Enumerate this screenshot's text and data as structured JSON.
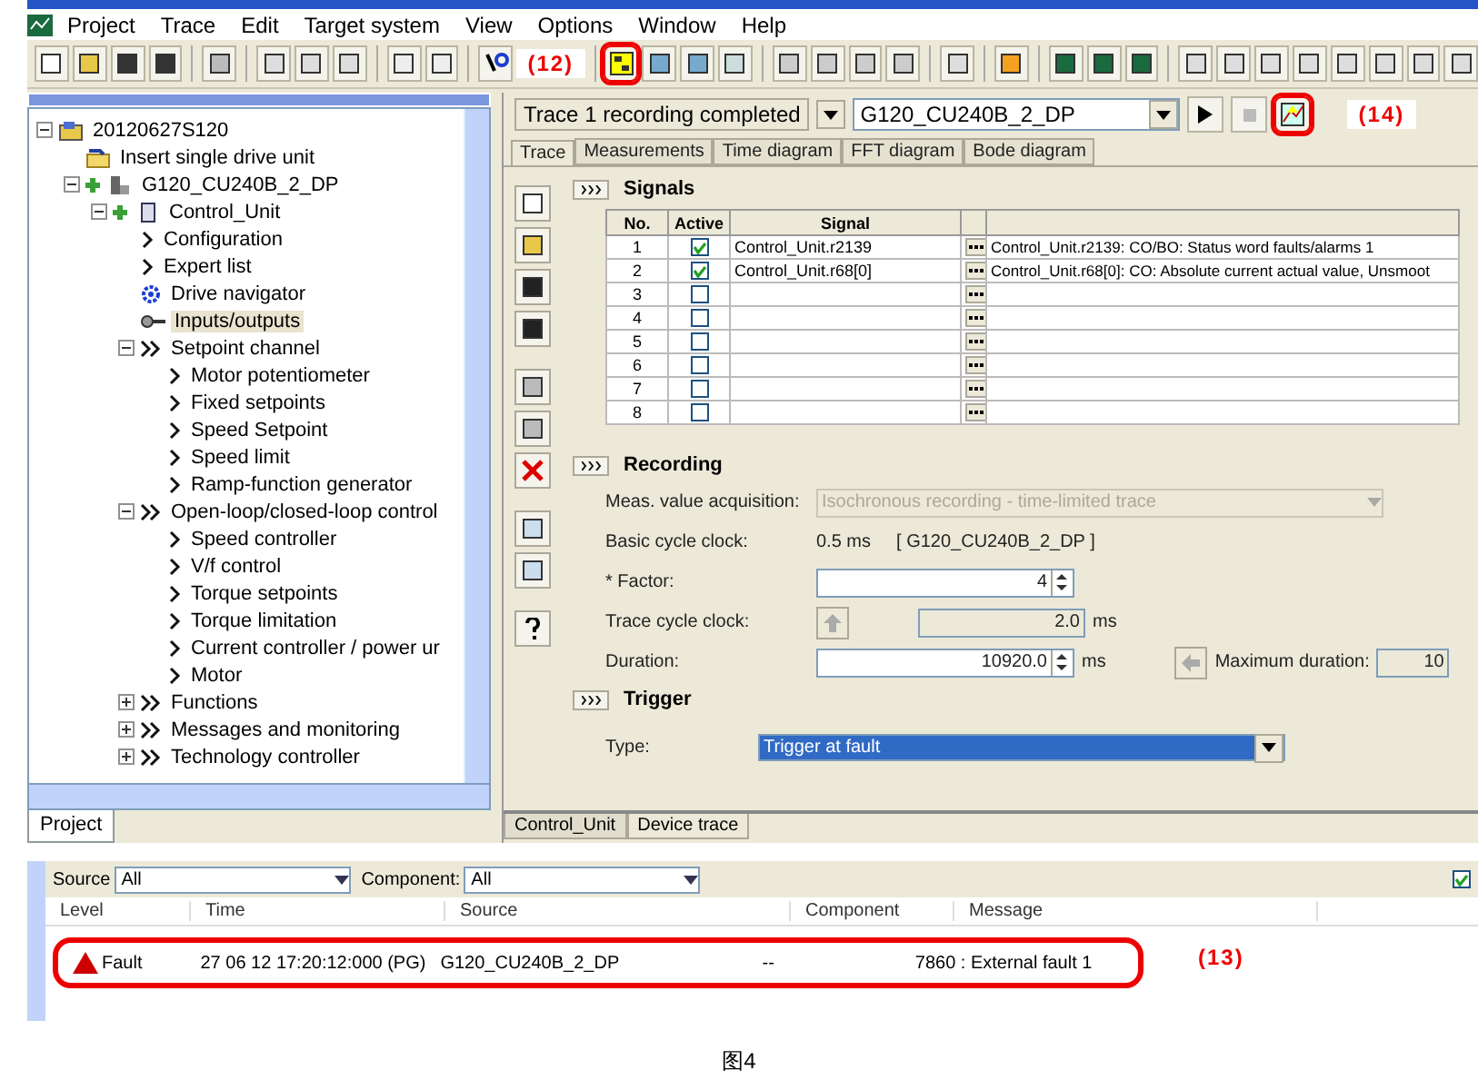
{
  "menu": [
    "Project",
    "Trace",
    "Edit",
    "Target system",
    "View",
    "Options",
    "Window",
    "Help"
  ],
  "toolbar": {
    "annotation": "(12)"
  },
  "project_tree": {
    "items": [
      {
        "label": "20120627S120",
        "kind": "project",
        "expanded": true,
        "selected": false,
        "children": [
          {
            "label": "Insert single drive unit",
            "kind": "insert",
            "selected": false
          },
          {
            "label": "G120_CU240B_2_DP",
            "kind": "drive",
            "expanded": true,
            "selected": false,
            "children": [
              {
                "label": "Control_Unit",
                "kind": "unit",
                "expanded": true,
                "selected": false,
                "children": [
                  {
                    "label": "Configuration",
                    "kind": "link",
                    "selected": false
                  },
                  {
                    "label": "Expert list",
                    "kind": "link",
                    "selected": false
                  },
                  {
                    "label": "Drive navigator",
                    "kind": "navigator",
                    "selected": false
                  },
                  {
                    "label": "Inputs/outputs",
                    "kind": "io",
                    "selected": true
                  },
                  {
                    "label": "Setpoint channel",
                    "kind": "group",
                    "expanded": true,
                    "selected": false,
                    "children": [
                      {
                        "label": "Motor potentiometer",
                        "kind": "link",
                        "selected": false
                      },
                      {
                        "label": "Fixed setpoints",
                        "kind": "link",
                        "selected": false
                      },
                      {
                        "label": "Speed Setpoint",
                        "kind": "link",
                        "selected": false
                      },
                      {
                        "label": "Speed limit",
                        "kind": "link",
                        "selected": false
                      },
                      {
                        "label": "Ramp-function generator",
                        "kind": "link",
                        "selected": false
                      }
                    ]
                  },
                  {
                    "label": "Open-loop/closed-loop control",
                    "kind": "group",
                    "expanded": true,
                    "selected": false,
                    "children": [
                      {
                        "label": "Speed controller",
                        "kind": "link",
                        "selected": false
                      },
                      {
                        "label": "V/f control",
                        "kind": "link",
                        "selected": false
                      },
                      {
                        "label": "Torque setpoints",
                        "kind": "link",
                        "selected": false
                      },
                      {
                        "label": "Torque limitation",
                        "kind": "link",
                        "selected": false
                      },
                      {
                        "label": "Current controller / power ur",
                        "kind": "link",
                        "selected": false
                      },
                      {
                        "label": "Motor",
                        "kind": "link",
                        "selected": false
                      }
                    ]
                  },
                  {
                    "label": "Functions",
                    "kind": "group",
                    "expanded": false,
                    "selected": false
                  },
                  {
                    "label": "Messages and monitoring",
                    "kind": "group",
                    "expanded": false,
                    "selected": false
                  },
                  {
                    "label": "Technology controller",
                    "kind": "group",
                    "expanded": false,
                    "selected": false
                  }
                ]
              }
            ]
          }
        ]
      }
    ],
    "tab": "Project"
  },
  "trace": {
    "status": "Trace 1 recording completed",
    "device": "G120_CU240B_2_DP",
    "annotation": "(14)",
    "tabs": [
      {
        "label": "Trace",
        "selected": true
      },
      {
        "label": "Measurements",
        "selected": false
      },
      {
        "label": "Time diagram",
        "selected": false
      },
      {
        "label": "FFT diagram",
        "selected": false
      },
      {
        "label": "Bode diagram",
        "selected": false
      }
    ],
    "signals": {
      "title": "Signals",
      "expanded": true,
      "columns": [
        "No.",
        "Active",
        "Signal"
      ],
      "rows": [
        {
          "no": "1",
          "active": true,
          "signal": "Control_Unit.r2139",
          "description": "Control_Unit.r2139: CO/BO: Status word faults/alarms 1"
        },
        {
          "no": "2",
          "active": true,
          "signal": "Control_Unit.r68[0]",
          "description": "Control_Unit.r68[0]: CO: Absolute current actual value, Unsmoot"
        },
        {
          "no": "3",
          "active": false
        },
        {
          "no": "4",
          "active": false
        },
        {
          "no": "5",
          "active": false
        },
        {
          "no": "6",
          "active": false
        },
        {
          "no": "7",
          "active": false
        },
        {
          "no": "8",
          "active": false
        }
      ]
    },
    "recording": {
      "title": "Recording",
      "expanded": true,
      "acquisition_label": "Meas. value acquisition:",
      "acquisition": "Isochronous recording - time-limited trace",
      "basic_clock_label": "Basic cycle clock:",
      "basic_clock": "0.5 ms",
      "basic_clock_device": "[ G120_CU240B_2_DP ]",
      "factor_label": "* Factor:",
      "factor": "4",
      "trace_clock_label": "Trace cycle clock:",
      "trace_clock": "2.0",
      "trace_clock_unit": "ms",
      "duration_label": "Duration:",
      "duration": "10920.0",
      "duration_unit": "ms",
      "max_duration_label": "Maximum duration:",
      "max_duration": "10"
    },
    "trigger": {
      "title": "Trigger",
      "expanded": true,
      "type_label": "Type:",
      "type": "Trigger at fault"
    }
  },
  "editor_tabs": [
    {
      "label": "Control_Unit",
      "selected": false
    },
    {
      "label": "Device trace",
      "selected": true
    }
  ],
  "log": {
    "source_label": "Source",
    "source": "All",
    "component_label": "Component:",
    "component": "All",
    "checked": true,
    "columns": [
      "Level",
      "Time",
      "Source",
      "Component",
      "Message"
    ],
    "rows": [
      {
        "level": "Fault",
        "time": "27 06 12   17:20:12:000 (PG)",
        "source": "G120_CU240B_2_DP",
        "component": "--",
        "message": "7860 : External fault 1",
        "highlighted": true
      }
    ],
    "annotation": "(13)"
  },
  "caption": "图4"
}
